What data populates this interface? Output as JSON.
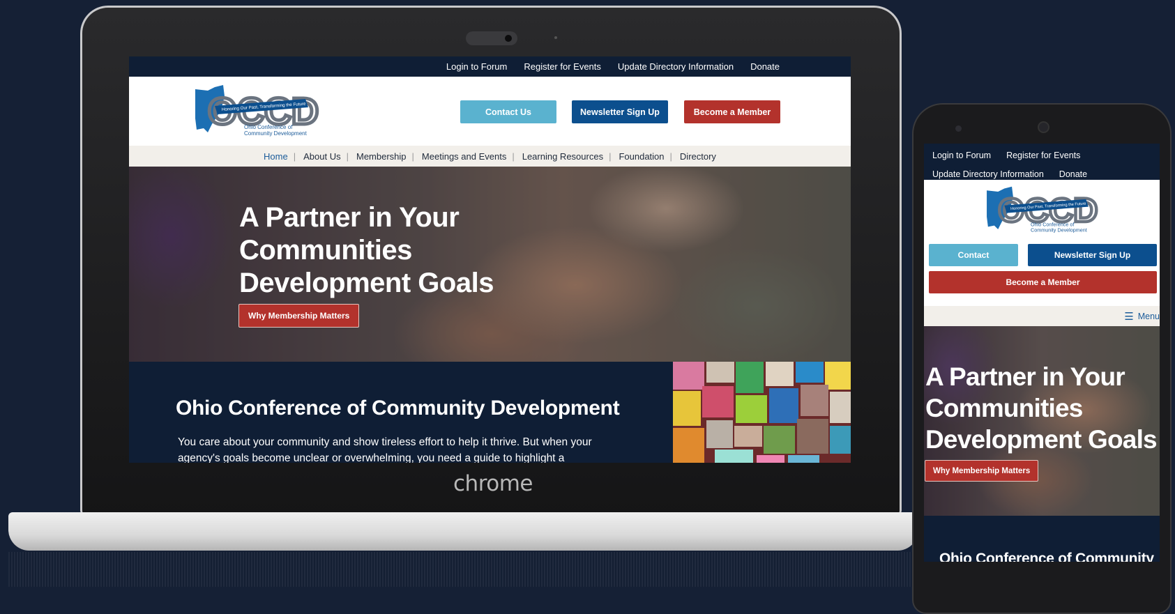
{
  "laptop": {
    "brand": "chrome",
    "topbar": {
      "links": [
        "Login to Forum",
        "Register for Events",
        "Update Directory Information",
        "Donate"
      ]
    },
    "logo": {
      "letters": "OCCD",
      "ribbon": "Honoring Our Past, Transforming the Future",
      "subtitle_line1": "Ohio Conference of",
      "subtitle_line2": "Community Development"
    },
    "header_buttons": {
      "contact": "Contact Us",
      "newsletter": "Newsletter Sign Up",
      "member": "Become a Member"
    },
    "nav": [
      "Home",
      "About Us",
      "Membership",
      "Meetings and Events",
      "Learning Resources",
      "Foundation",
      "Directory"
    ],
    "hero": {
      "title_line1": "A Partner in Your",
      "title_line2": "Communities",
      "title_line3": "Development Goals",
      "button": "Why Membership Matters"
    },
    "intro": {
      "title": "Ohio Conference of Community Development",
      "text": "You care about your community and show tireless effort to help it thrive. But when your agency's goals become unclear or overwhelming, you need a guide to highlight a"
    }
  },
  "phone": {
    "topbar": {
      "row1": [
        "Login to Forum",
        "Register for Events"
      ],
      "row2": [
        "Update Directory Information",
        "Donate"
      ]
    },
    "buttons": {
      "contact": "Contact",
      "newsletter": "Newsletter Sign Up",
      "member": "Become a Member"
    },
    "menu_label": "Menu",
    "hero": {
      "title_line1": "A Partner in Your",
      "title_line2": "Communities",
      "title_line3": "Development Goals",
      "button": "Why Membership Matters"
    },
    "intro_title": "Ohio Conference of Community"
  },
  "colors": {
    "navy": "#0f1e35",
    "light_blue": "#5ab2cf",
    "dark_blue": "#0c4f8e",
    "red": "#b3322c",
    "nav_bg": "#f2efea",
    "active_link": "#1c5c9a"
  }
}
